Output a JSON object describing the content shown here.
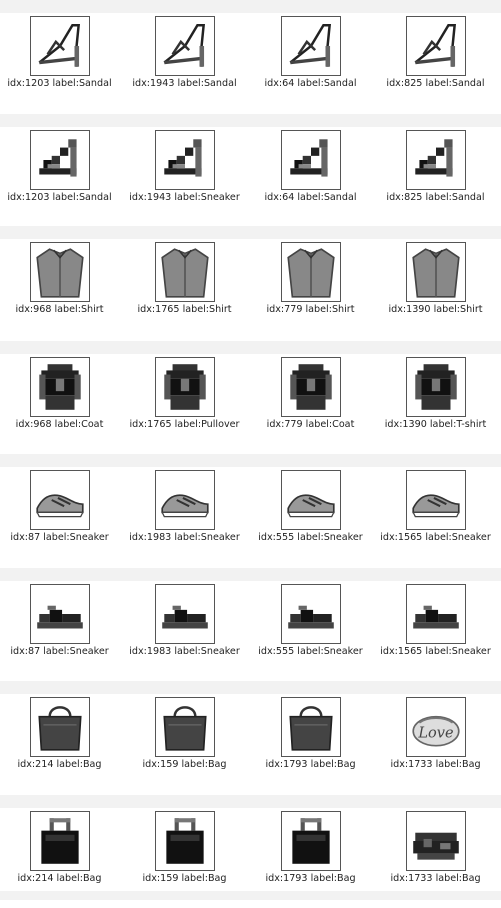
{
  "rows": [
    {
      "kind": "photo",
      "cells": [
        {
          "idx": "1203",
          "label": "Sandal",
          "caption": "idx:1203  label:Sandal",
          "icon": "sandal-icon"
        },
        {
          "idx": "1943",
          "label": "Sandal",
          "caption": "idx:1943  label:Sandal",
          "icon": "sandal-icon"
        },
        {
          "idx": "64",
          "label": "Sandal",
          "caption": "idx:64  label:Sandal",
          "icon": "sandal-icon"
        },
        {
          "idx": "825",
          "label": "Sandal",
          "caption": "idx:825  label:Sandal",
          "icon": "sandal-icon"
        }
      ]
    },
    {
      "kind": "pixel",
      "cells": [
        {
          "idx": "1203",
          "label": "Sandal",
          "caption": "idx:1203  label:Sandal",
          "icon": "sandal-icon"
        },
        {
          "idx": "1943",
          "label": "Sneaker",
          "caption": "idx:1943  label:Sneaker",
          "icon": "sandal-icon"
        },
        {
          "idx": "64",
          "label": "Sandal",
          "caption": "idx:64  label:Sandal",
          "icon": "sandal-icon"
        },
        {
          "idx": "825",
          "label": "Sandal",
          "caption": "idx:825  label:Sandal",
          "icon": "sandal-icon"
        }
      ]
    },
    {
      "kind": "photo",
      "cells": [
        {
          "idx": "968",
          "label": "Shirt",
          "caption": "idx:968  label:Shirt",
          "icon": "shirt-icon"
        },
        {
          "idx": "1765",
          "label": "Shirt",
          "caption": "idx:1765  label:Shirt",
          "icon": "shirt-icon"
        },
        {
          "idx": "779",
          "label": "Shirt",
          "caption": "idx:779  label:Shirt",
          "icon": "shirt-icon"
        },
        {
          "idx": "1390",
          "label": "Shirt",
          "caption": "idx:1390  label:Shirt",
          "icon": "shirt-icon"
        }
      ]
    },
    {
      "kind": "pixel",
      "cells": [
        {
          "idx": "968",
          "label": "Coat",
          "caption": "idx:968  label:Coat",
          "icon": "shirt-icon"
        },
        {
          "idx": "1765",
          "label": "Pullover",
          "caption": "idx:1765  label:Pullover",
          "icon": "shirt-icon"
        },
        {
          "idx": "779",
          "label": "Coat",
          "caption": "idx:779  label:Coat",
          "icon": "shirt-icon"
        },
        {
          "idx": "1390",
          "label": "T-shirt",
          "caption": "idx:1390  label:T-shirt",
          "icon": "shirt-icon"
        }
      ]
    },
    {
      "kind": "photo",
      "cells": [
        {
          "idx": "87",
          "label": "Sneaker",
          "caption": "idx:87  label:Sneaker",
          "icon": "sneaker-icon"
        },
        {
          "idx": "1983",
          "label": "Sneaker",
          "caption": "idx:1983  label:Sneaker",
          "icon": "sneaker-icon"
        },
        {
          "idx": "555",
          "label": "Sneaker",
          "caption": "idx:555  label:Sneaker",
          "icon": "sneaker-icon"
        },
        {
          "idx": "1565",
          "label": "Sneaker",
          "caption": "idx:1565  label:Sneaker",
          "icon": "sneaker-icon"
        }
      ]
    },
    {
      "kind": "pixel",
      "cells": [
        {
          "idx": "87",
          "label": "Sneaker",
          "caption": "idx:87  label:Sneaker",
          "icon": "sneaker-icon"
        },
        {
          "idx": "1983",
          "label": "Sneaker",
          "caption": "idx:1983  label:Sneaker",
          "icon": "sneaker-icon"
        },
        {
          "idx": "555",
          "label": "Sneaker",
          "caption": "idx:555  label:Sneaker",
          "icon": "sneaker-icon"
        },
        {
          "idx": "1565",
          "label": "Sneaker",
          "caption": "idx:1565  label:Sneaker",
          "icon": "sneaker-icon"
        }
      ]
    },
    {
      "kind": "photo",
      "cells": [
        {
          "idx": "214",
          "label": "Bag",
          "caption": "idx:214  label:Bag",
          "icon": "bag-icon"
        },
        {
          "idx": "159",
          "label": "Bag",
          "caption": "idx:159  label:Bag",
          "icon": "bag-icon"
        },
        {
          "idx": "1793",
          "label": "Bag",
          "caption": "idx:1793  label:Bag",
          "icon": "bag-icon"
        },
        {
          "idx": "1733",
          "label": "Bag",
          "caption": "idx:1733  label:Bag",
          "icon": "clutch-icon",
          "print": "Love"
        }
      ]
    },
    {
      "kind": "pixel",
      "cells": [
        {
          "idx": "214",
          "label": "Bag",
          "caption": "idx:214  label:Bag",
          "icon": "bag-icon"
        },
        {
          "idx": "159",
          "label": "Bag",
          "caption": "idx:159  label:Bag",
          "icon": "bag-icon"
        },
        {
          "idx": "1793",
          "label": "Bag",
          "caption": "idx:1793  label:Bag",
          "icon": "bag-icon"
        },
        {
          "idx": "1733",
          "label": "Bag",
          "caption": "idx:1733  label:Bag",
          "icon": "clutch-icon"
        }
      ]
    }
  ],
  "colors": {
    "band": "#f2f2f2",
    "frame": "#555555",
    "text": "#222222"
  }
}
